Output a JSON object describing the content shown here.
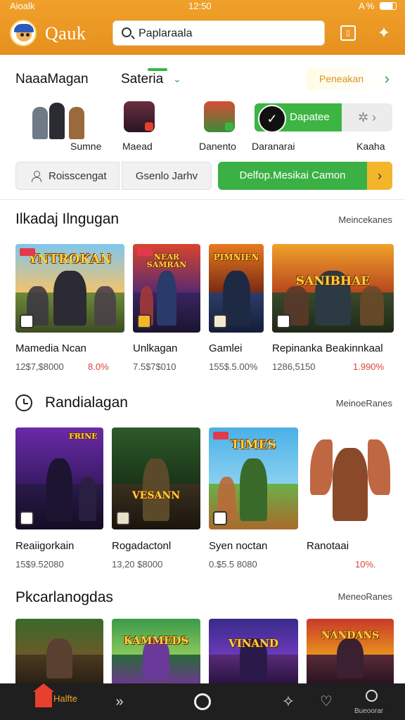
{
  "status_bar": {
    "carrier": "Aioalk",
    "time": "12:50",
    "battery": "A%"
  },
  "header": {
    "brand": "Qauk",
    "search_value": "Paplaraala"
  },
  "tabs": {
    "primary": "NaaaMagan",
    "secondary": "Sateria",
    "promo": "Peneakan"
  },
  "categories": [
    {
      "label": "Sumne"
    },
    {
      "label": "Maead"
    },
    {
      "label": "Danento"
    },
    {
      "label": "Daranarai"
    },
    {
      "label": "Kaaha"
    }
  ],
  "featured_pill": {
    "label": "Dapatee"
  },
  "filters": [
    {
      "label": "Roisscengat"
    },
    {
      "label": "Gsenlo Jarhv"
    },
    {
      "label": "Delfop.Mesikai Camon"
    }
  ],
  "sections": [
    {
      "title": "Ilkadaj Ilngugan",
      "more": "Meincekanes",
      "items": [
        {
          "art": "YNTROKAN",
          "name": "Mamedia Ncan",
          "price": "12$7,$8000",
          "delta": "8.0%"
        },
        {
          "art": "NEAR SAMRAN",
          "name": "Unlkagan",
          "price": "7.5$7$010",
          "delta": ""
        },
        {
          "art": "PIMNIEN",
          "name": "Gamlei",
          "price": "155$.5.00%",
          "delta": ""
        },
        {
          "art": "SANIBHAE",
          "name": "Repinanka Beakinnkaal",
          "price": "1286,5150",
          "delta": "1.990%"
        }
      ]
    },
    {
      "title": "Randialagan",
      "more": "MeinoeRanes",
      "items": [
        {
          "art": "FRINE",
          "name": "Reaiigorkain",
          "price": "15$9.52080",
          "delta": ""
        },
        {
          "art": "VESANN",
          "name": "Rogadactonl",
          "price": "13,20 $8000",
          "delta": ""
        },
        {
          "art": "TIMES",
          "name": "Syen noctan",
          "price": "0.$5.5 8080",
          "delta": ""
        },
        {
          "art": "",
          "name": "Ranotaai",
          "price": "",
          "delta": "10%."
        }
      ]
    },
    {
      "title": "Pkcarlanogdas",
      "more": "MeneoRanes",
      "items": [
        {
          "art": ""
        },
        {
          "art": "KAMMEDS"
        },
        {
          "art": "VINAND"
        },
        {
          "art": "NANDANS"
        }
      ]
    }
  ],
  "bottom_nav": {
    "home": "Halfte",
    "profile": "Bueoorar"
  }
}
